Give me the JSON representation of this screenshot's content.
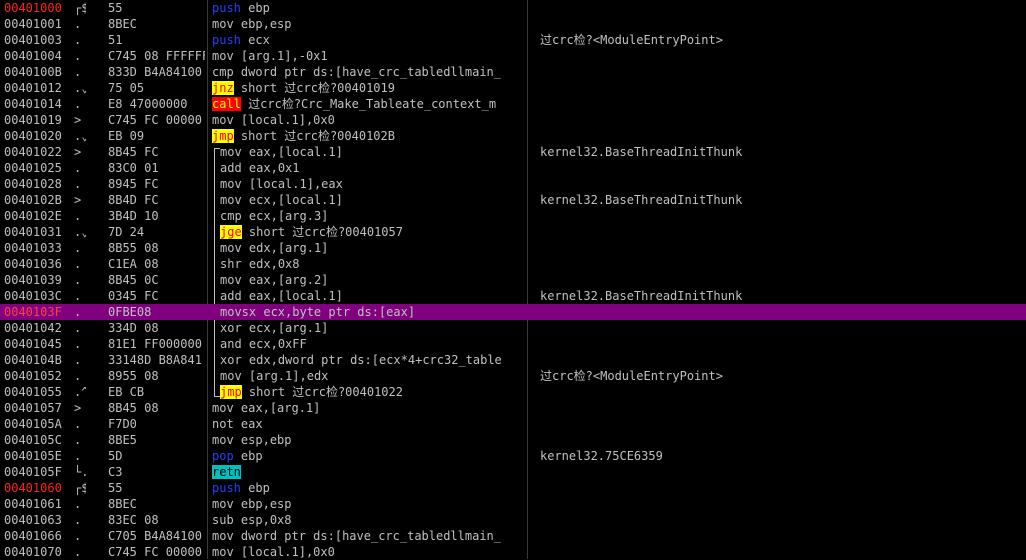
{
  "rows": [
    {
      "addr": "00401000",
      "addr_red": true,
      "mark": "┌$",
      "bytes": "55",
      "mn": "push",
      "mtype": "push",
      "ops": "ebp",
      "cmt": ""
    },
    {
      "addr": "00401001",
      "mark": ".",
      "bytes": "8BEC",
      "mn": "mov",
      "mtype": "plain",
      "ops": "ebp,esp",
      "cmt": ""
    },
    {
      "addr": "00401003",
      "mark": ".",
      "bytes": "51",
      "mn": "push",
      "mtype": "push",
      "ops": "ecx",
      "cmt": "过crc检?<ModuleEntryPoint>"
    },
    {
      "addr": "00401004",
      "mark": ".",
      "bytes": "C745 08 FFFFFF",
      "mn": "mov",
      "mtype": "plain",
      "ops": "[arg.1],-0x1",
      "cmt": ""
    },
    {
      "addr": "0040100B",
      "mark": ".",
      "bytes": "833D B4A84100",
      "mn": "cmp",
      "mtype": "plain",
      "ops": "dword ptr ds:[have_crc_tabledllmain_",
      "cmt": ""
    },
    {
      "addr": "00401012",
      "mark": ".⌄",
      "bytes": "75 05",
      "mn": "jnz",
      "mtype": "jcc",
      "ops": "short 过crc检?00401019",
      "cmt": ""
    },
    {
      "addr": "00401014",
      "mark": ".",
      "bytes": "E8 47000000",
      "mn": "call",
      "mtype": "call",
      "ops": "过crc检?Crc_Make_Tableate_context_m",
      "cmt": ""
    },
    {
      "addr": "00401019",
      "mark": ">",
      "bytes": "C745 FC 00000",
      "mn": "mov",
      "mtype": "plain",
      "ops": "[local.1],0x0",
      "cmt": ""
    },
    {
      "addr": "00401020",
      "mark": ".⌄",
      "bytes": "EB 09",
      "mn": "jmp",
      "mtype": "jmp",
      "ops": "short 过crc检?0040102B",
      "cmt": ""
    },
    {
      "addr": "00401022",
      "mark": ">",
      "bytes": "8B45 FC",
      "mn": "mov",
      "mtype": "plain",
      "ops": "eax,[local.1]",
      "cmt": "kernel32.BaseThreadInitThunk",
      "indent": true
    },
    {
      "addr": "00401025",
      "mark": ".",
      "bytes": "83C0 01",
      "mn": "add",
      "mtype": "plain",
      "ops": "eax,0x1",
      "cmt": "",
      "indent": true
    },
    {
      "addr": "00401028",
      "mark": ".",
      "bytes": "8945 FC",
      "mn": "mov",
      "mtype": "plain",
      "ops": "[local.1],eax",
      "cmt": "",
      "indent": true
    },
    {
      "addr": "0040102B",
      "mark": ">",
      "bytes": "8B4D FC",
      "mn": "mov",
      "mtype": "plain",
      "ops": "ecx,[local.1]",
      "cmt": "kernel32.BaseThreadInitThunk",
      "indent": true
    },
    {
      "addr": "0040102E",
      "mark": ".",
      "bytes": "3B4D 10",
      "mn": "cmp",
      "mtype": "plain",
      "ops": "ecx,[arg.3]",
      "cmt": "",
      "indent": true
    },
    {
      "addr": "00401031",
      "mark": ".⌄",
      "bytes": "7D 24",
      "mn": "jge",
      "mtype": "jcc",
      "ops": "short 过crc检?00401057",
      "cmt": "",
      "indent": true
    },
    {
      "addr": "00401033",
      "mark": ".",
      "bytes": "8B55 08",
      "mn": "mov",
      "mtype": "plain",
      "ops": "edx,[arg.1]",
      "cmt": "",
      "indent": true
    },
    {
      "addr": "00401036",
      "mark": ".",
      "bytes": "C1EA 08",
      "mn": "shr",
      "mtype": "plain",
      "ops": "edx,0x8",
      "cmt": "",
      "indent": true
    },
    {
      "addr": "00401039",
      "mark": ".",
      "bytes": "8B45 0C",
      "mn": "mov",
      "mtype": "plain",
      "ops": "eax,[arg.2]",
      "cmt": "",
      "indent": true
    },
    {
      "addr": "0040103C",
      "mark": ".",
      "bytes": "0345 FC",
      "mn": "add",
      "mtype": "plain",
      "ops": "eax,[local.1]",
      "cmt": "kernel32.BaseThreadInitThunk",
      "indent": true
    },
    {
      "addr": "0040103F",
      "addr_red": true,
      "sel": true,
      "mark": ".",
      "bytes": "0FBE08",
      "mn": "movsx",
      "mtype": "plain",
      "ops": "ecx,byte ptr ds:[eax]",
      "cmt": "",
      "indent": true
    },
    {
      "addr": "00401042",
      "mark": ".",
      "bytes": "334D 08",
      "mn": "xor",
      "mtype": "plain",
      "ops": "ecx,[arg.1]",
      "cmt": "",
      "indent": true
    },
    {
      "addr": "00401045",
      "mark": ".",
      "bytes": "81E1 FF000000",
      "mn": "and",
      "mtype": "plain",
      "ops": "ecx,0xFF",
      "cmt": "",
      "indent": true
    },
    {
      "addr": "0040104B",
      "mark": ".",
      "bytes": "33148D B8A841",
      "mn": "xor",
      "mtype": "plain",
      "ops": "edx,dword ptr ds:[ecx*4+crc32_table",
      "cmt": "",
      "indent": true
    },
    {
      "addr": "00401052",
      "mark": ".",
      "bytes": "8955 08",
      "mn": "mov",
      "mtype": "plain",
      "ops": "[arg.1],edx",
      "cmt": "过crc检?<ModuleEntryPoint>",
      "indent": true
    },
    {
      "addr": "00401055",
      "mark": ".^",
      "bytes": "EB CB",
      "mn": "jmp",
      "mtype": "jmp",
      "ops": "short 过crc检?00401022",
      "cmt": "",
      "indent": true
    },
    {
      "addr": "00401057",
      "mark": ">",
      "bytes": "8B45 08",
      "mn": "mov",
      "mtype": "plain",
      "ops": "eax,[arg.1]",
      "cmt": ""
    },
    {
      "addr": "0040105A",
      "mark": ".",
      "bytes": "F7D0",
      "mn": "not",
      "mtype": "plain",
      "ops": "eax",
      "cmt": ""
    },
    {
      "addr": "0040105C",
      "mark": ".",
      "bytes": "8BE5",
      "mn": "mov",
      "mtype": "plain",
      "ops": "esp,ebp",
      "cmt": ""
    },
    {
      "addr": "0040105E",
      "mark": ".",
      "bytes": "5D",
      "mn": "pop",
      "mtype": "pop",
      "ops": "ebp",
      "cmt": "kernel32.75CE6359"
    },
    {
      "addr": "0040105F",
      "mark": "└.",
      "bytes": "C3",
      "mn": "retn",
      "mtype": "retn",
      "ops": "",
      "cmt": ""
    },
    {
      "addr": "00401060",
      "addr_red": true,
      "mark": "┌$",
      "bytes": "55",
      "mn": "push",
      "mtype": "push",
      "ops": "ebp",
      "cmt": ""
    },
    {
      "addr": "00401061",
      "mark": ".",
      "bytes": "8BEC",
      "mn": "mov",
      "mtype": "plain",
      "ops": "ebp,esp",
      "cmt": ""
    },
    {
      "addr": "00401063",
      "mark": ".",
      "bytes": "83EC 08",
      "mn": "sub",
      "mtype": "plain",
      "ops": "esp,0x8",
      "cmt": ""
    },
    {
      "addr": "00401066",
      "mark": ".",
      "bytes": "C705 B4A84100",
      "mn": "mov",
      "mtype": "plain",
      "ops": "dword ptr ds:[have_crc_tabledllmain_",
      "cmt": ""
    },
    {
      "addr": "00401070",
      "mark": ".",
      "bytes": "C745 FC 00000",
      "mn": "mov",
      "mtype": "plain",
      "ops": "[local.1],0x0",
      "cmt": ""
    }
  ]
}
